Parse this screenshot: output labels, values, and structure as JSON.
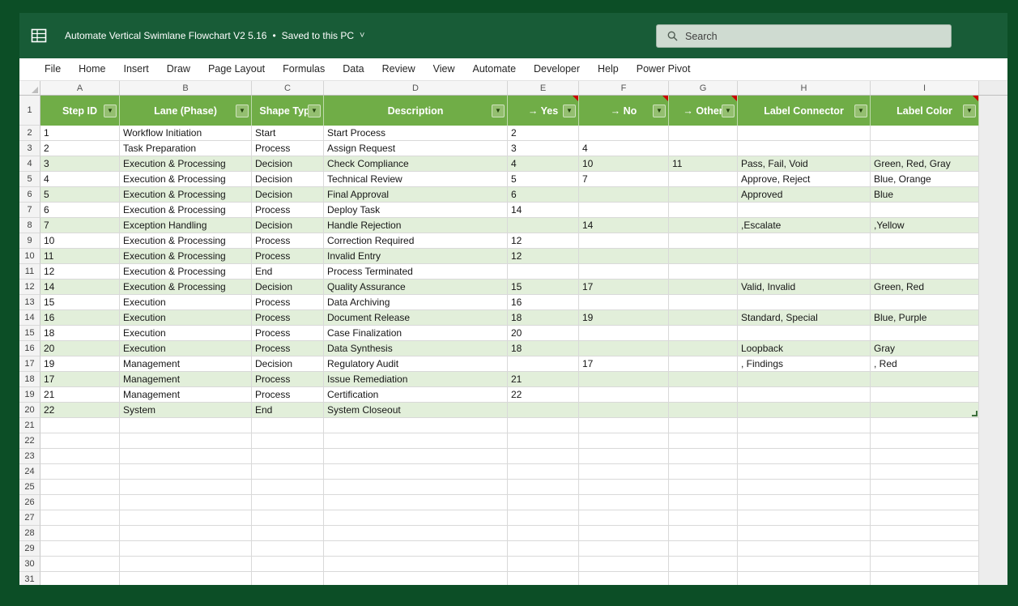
{
  "window": {
    "title": "Automate Vertical Swimlane Flowchart V2 5.16",
    "separator": "•",
    "title_suffix": "Saved to this PC",
    "chevron": "˅",
    "search_placeholder": "Search"
  },
  "menu": {
    "items": [
      "File",
      "Home",
      "Insert",
      "Draw",
      "Page Layout",
      "Formulas",
      "Data",
      "Review",
      "View",
      "Automate",
      "Developer",
      "Help",
      "Power Pivot"
    ]
  },
  "sheet": {
    "column_letters": [
      "A",
      "B",
      "C",
      "D",
      "E",
      "F",
      "G",
      "H",
      "I"
    ],
    "table_headers": [
      {
        "label": "Step ID",
        "comment": false
      },
      {
        "label": "Lane (Phase)",
        "comment": false
      },
      {
        "label": "Shape Type",
        "comment": false
      },
      {
        "label": "Description",
        "comment": false
      },
      {
        "label": "→ Yes",
        "comment": true
      },
      {
        "label": "→ No",
        "comment": true
      },
      {
        "label": "→ Other",
        "comment": true
      },
      {
        "label": "Label Connector",
        "comment": false
      },
      {
        "label": "Label Color",
        "comment": true
      }
    ],
    "rows": [
      {
        "n": 2,
        "cells": [
          "1",
          "Workflow Initiation",
          "Start",
          "Start Process",
          "2",
          "",
          "",
          "",
          ""
        ]
      },
      {
        "n": 3,
        "cells": [
          "2",
          "Task Preparation",
          "Process",
          "Assign Request",
          "3",
          "4",
          "",
          "",
          ""
        ]
      },
      {
        "n": 4,
        "cells": [
          "3",
          "Execution & Processing",
          "Decision",
          "Check Compliance",
          "4",
          "10",
          "11",
          "Pass, Fail, Void",
          "Green, Red, Gray"
        ]
      },
      {
        "n": 5,
        "cells": [
          "4",
          "Execution & Processing",
          "Decision",
          "Technical Review",
          "5",
          "7",
          "",
          "Approve, Reject",
          "Blue, Orange"
        ]
      },
      {
        "n": 6,
        "cells": [
          "5",
          "Execution & Processing",
          "Decision",
          "Final Approval",
          "6",
          "",
          "",
          "Approved",
          "Blue"
        ]
      },
      {
        "n": 7,
        "cells": [
          "6",
          "Execution & Processing",
          "Process",
          "Deploy Task",
          "14",
          "",
          "",
          "",
          ""
        ]
      },
      {
        "n": 8,
        "cells": [
          "7",
          "Exception Handling",
          "Decision",
          "Handle Rejection",
          "",
          "14",
          "",
          ",Escalate",
          ",Yellow"
        ]
      },
      {
        "n": 9,
        "cells": [
          "10",
          "Execution & Processing",
          "Process",
          "Correction Required",
          "12",
          "",
          "",
          "",
          ""
        ]
      },
      {
        "n": 10,
        "cells": [
          "11",
          "Execution & Processing",
          "Process",
          "Invalid Entry",
          "12",
          "",
          "",
          "",
          ""
        ]
      },
      {
        "n": 11,
        "cells": [
          "12",
          "Execution & Processing",
          "End",
          "Process Terminated",
          "",
          "",
          "",
          "",
          ""
        ]
      },
      {
        "n": 12,
        "cells": [
          "14",
          "Execution & Processing",
          "Decision",
          "Quality Assurance",
          "15",
          "17",
          "",
          "Valid, Invalid",
          "Green, Red"
        ]
      },
      {
        "n": 13,
        "cells": [
          "15",
          "Execution",
          "Process",
          "Data Archiving",
          "16",
          "",
          "",
          "",
          ""
        ]
      },
      {
        "n": 14,
        "cells": [
          "16",
          "Execution",
          "Process",
          "Document Release",
          "18",
          "19",
          "",
          "Standard, Special",
          "Blue, Purple"
        ]
      },
      {
        "n": 15,
        "cells": [
          "18",
          "Execution",
          "Process",
          "Case Finalization",
          "20",
          "",
          "",
          "",
          ""
        ]
      },
      {
        "n": 16,
        "cells": [
          "20",
          "Execution",
          "Process",
          "Data Synthesis",
          "18",
          "",
          "",
          "Loopback",
          "Gray"
        ]
      },
      {
        "n": 17,
        "cells": [
          "19",
          "Management",
          "Decision",
          "Regulatory Audit",
          "",
          "17",
          "",
          ", Findings",
          ", Red"
        ]
      },
      {
        "n": 18,
        "cells": [
          "17",
          "Management",
          "Process",
          "Issue Remediation",
          "21",
          "",
          "",
          "",
          ""
        ]
      },
      {
        "n": 19,
        "cells": [
          "21",
          "Management",
          "Process",
          "Certification",
          "22",
          "",
          "",
          "",
          ""
        ]
      },
      {
        "n": 20,
        "cells": [
          "22",
          "System",
          "End",
          "System Closeout",
          "",
          "",
          "",
          "",
          ""
        ]
      }
    ],
    "empty_rows_from": 21,
    "empty_rows_to": 31
  },
  "colors": {
    "frame": "#0c4e26",
    "titlebar": "#185c37",
    "table_header_green": "#70ad47",
    "banded_row": "#e2efda",
    "comment_flag_red": "#cc0000",
    "search_box": "#cfdbd1"
  }
}
